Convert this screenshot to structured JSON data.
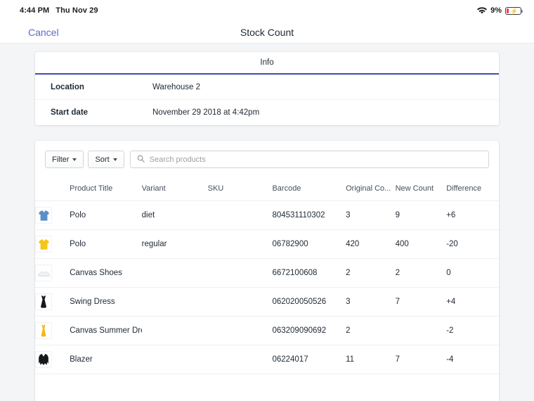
{
  "status_bar": {
    "time": "4:44 PM",
    "date": "Thu Nov 29",
    "wifi_icon": "wifi-icon",
    "battery_percent": "9%",
    "battery_icon": "battery-charging-icon"
  },
  "nav": {
    "cancel_label": "Cancel",
    "title": "Stock Count"
  },
  "info_card": {
    "tab_label": "Info",
    "rows": [
      {
        "key": "Location",
        "value": "Warehouse 2"
      },
      {
        "key": "Start date",
        "value": "November 29 2018 at 4:42pm"
      }
    ]
  },
  "toolbar": {
    "filter_label": "Filter",
    "sort_label": "Sort",
    "search_placeholder": "Search products",
    "search_value": "",
    "search_icon": "search-icon",
    "caret_icon": "chevron-down-icon"
  },
  "table": {
    "headers": [
      "",
      "Product Title",
      "Variant",
      "SKU",
      "Barcode",
      "Original Co...",
      "New Count",
      "Difference"
    ],
    "rows": [
      {
        "thumb": "blue-polo-shirt-icon",
        "title": "Polo",
        "variant": "diet",
        "sku": "",
        "barcode": "804531110302",
        "original_count": "3",
        "new_count": "9",
        "difference": "+6",
        "difference_sign": "positive"
      },
      {
        "thumb": "yellow-polo-shirt-icon",
        "title": "Polo",
        "variant": "regular",
        "sku": "",
        "barcode": "06782900",
        "original_count": "420",
        "new_count": "400",
        "difference": "-20",
        "difference_sign": "negative"
      },
      {
        "thumb": "white-canvas-shoe-icon",
        "title": "Canvas Shoes",
        "variant": "",
        "sku": "",
        "barcode": "6672100608",
        "original_count": "2",
        "new_count": "2",
        "difference": "0",
        "difference_sign": "zero"
      },
      {
        "thumb": "black-swing-dress-icon",
        "title": "Swing Dress",
        "variant": "",
        "sku": "",
        "barcode": "062020050526",
        "original_count": "3",
        "new_count": "7",
        "difference": "+4",
        "difference_sign": "positive"
      },
      {
        "thumb": "yellow-summer-dress-icon",
        "title": "Canvas Summer Dress",
        "variant": "",
        "sku": "",
        "barcode": "063209090692",
        "original_count": "2",
        "new_count": "",
        "difference": "-2",
        "difference_sign": "negative"
      },
      {
        "thumb": "black-blazer-icon",
        "title": "Blazer",
        "variant": "",
        "sku": "",
        "barcode": "06224017",
        "original_count": "11",
        "new_count": "7",
        "difference": "-4",
        "difference_sign": "negative"
      }
    ]
  },
  "colors": {
    "accent": "#5c6ac4",
    "tab_underline": "#3f4eae",
    "positive": "#108043",
    "negative": "#e02020",
    "background": "#f4f5f7",
    "battery_low": "#ff3b30"
  }
}
